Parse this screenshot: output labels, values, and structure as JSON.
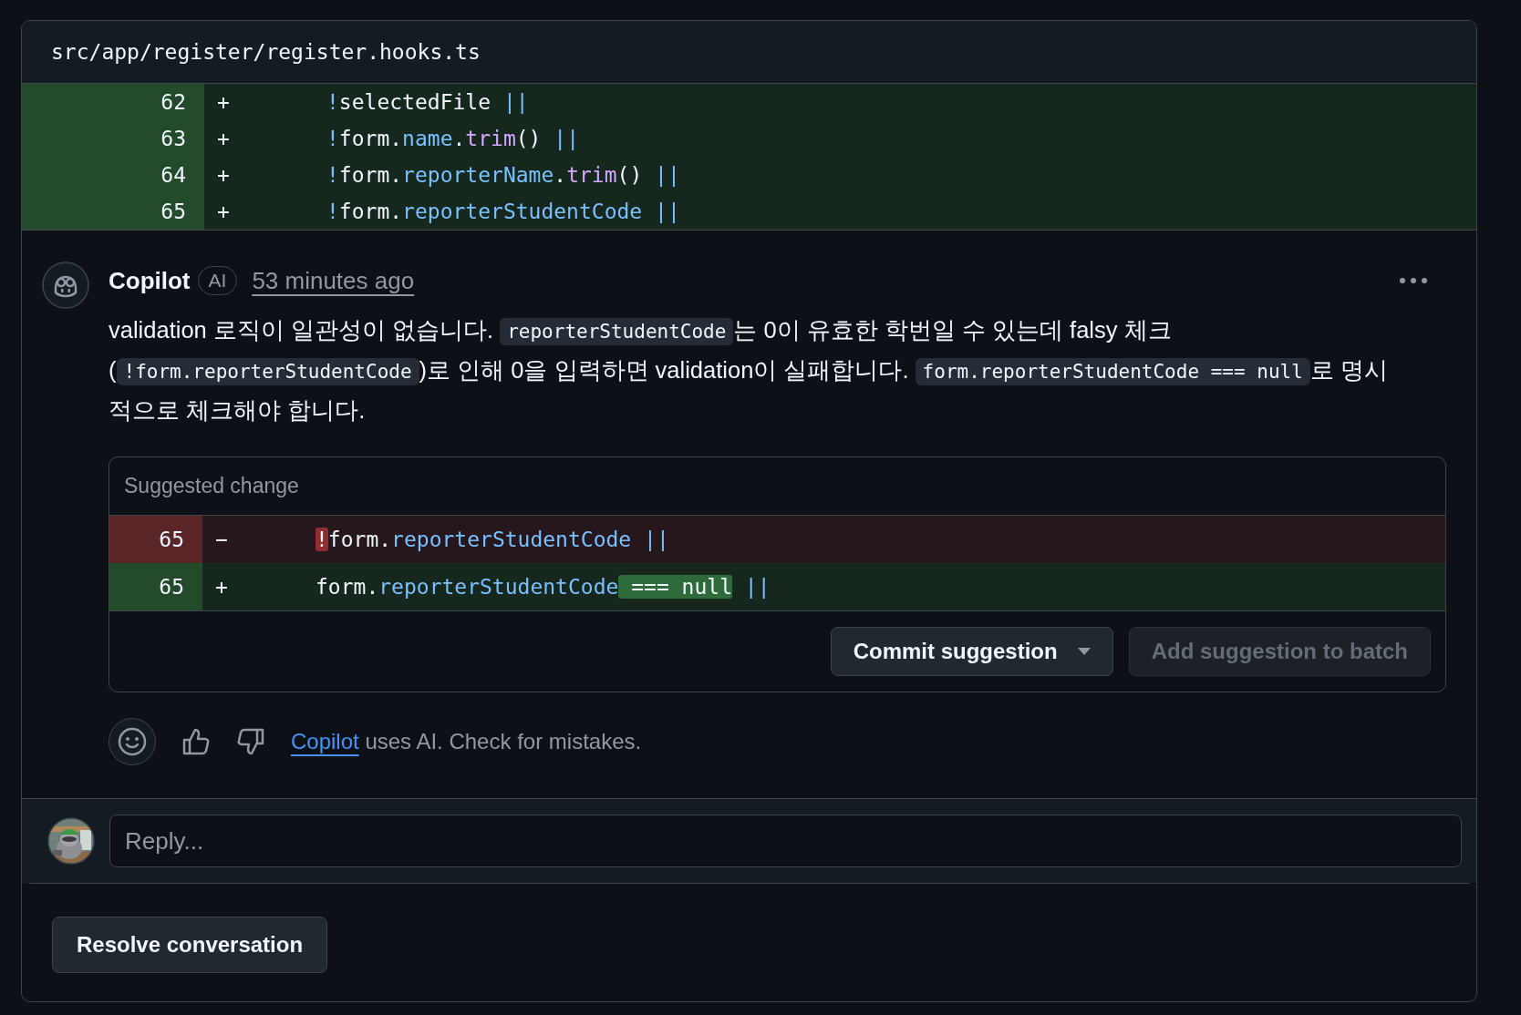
{
  "file_header": {
    "path": "src/app/register/register.hooks.ts"
  },
  "diff_lines": [
    {
      "line_number": "62",
      "sign": "+",
      "kind": "added",
      "tokens": [
        {
          "text": "!",
          "kind": "op"
        },
        {
          "text": "selectedFile",
          "kind": "plain"
        },
        {
          "text": " ||",
          "kind": "op"
        }
      ]
    },
    {
      "line_number": "63",
      "sign": "+",
      "kind": "added",
      "tokens": [
        {
          "text": "!",
          "kind": "op"
        },
        {
          "text": "form.",
          "kind": "plain"
        },
        {
          "text": "name",
          "kind": "prop"
        },
        {
          "text": ".",
          "kind": "plain"
        },
        {
          "text": "trim",
          "kind": "method"
        },
        {
          "text": "() ",
          "kind": "plain"
        },
        {
          "text": "||",
          "kind": "op"
        }
      ]
    },
    {
      "line_number": "64",
      "sign": "+",
      "kind": "added",
      "tokens": [
        {
          "text": "!",
          "kind": "op"
        },
        {
          "text": "form.",
          "kind": "plain"
        },
        {
          "text": "reporterName",
          "kind": "prop"
        },
        {
          "text": ".",
          "kind": "plain"
        },
        {
          "text": "trim",
          "kind": "method"
        },
        {
          "text": "() ",
          "kind": "plain"
        },
        {
          "text": "||",
          "kind": "op"
        }
      ]
    },
    {
      "line_number": "65",
      "sign": "+",
      "kind": "added",
      "tokens": [
        {
          "text": "!",
          "kind": "op"
        },
        {
          "text": "form.",
          "kind": "plain"
        },
        {
          "text": "reporterStudentCode",
          "kind": "prop"
        },
        {
          "text": " ||",
          "kind": "op"
        }
      ]
    }
  ],
  "comment": {
    "author": "Copilot",
    "badge": "AI",
    "time": "53 minutes ago",
    "body": [
      {
        "text": "validation 로직이 일관성이 없습니다. ",
        "kind": "text"
      },
      {
        "text": "reporterStudentCode",
        "kind": "code"
      },
      {
        "text": "는 0이 유효한 학번일 수 있는데 falsy 체크 (",
        "kind": "text"
      },
      {
        "text": "!form.reporterStudentCode",
        "kind": "code"
      },
      {
        "text": ")로 인해 0을 입력하면 validation이 실패합니다. ",
        "kind": "text"
      },
      {
        "text": "form.reporterStudentCode === null",
        "kind": "code"
      },
      {
        "text": "로 명시적으로 체크해야 합니다.",
        "kind": "text"
      }
    ],
    "suggestion": {
      "title": "Suggested change",
      "lines": [
        {
          "line_number": "65",
          "sign": "−",
          "kind": "deleted",
          "tokens": [
            {
              "text": "!",
              "kind": "deleted_highlight"
            },
            {
              "text": "form.",
              "kind": "plain"
            },
            {
              "text": "reporterStudentCode",
              "kind": "prop"
            },
            {
              "text": " ||",
              "kind": "op"
            }
          ]
        },
        {
          "line_number": "65",
          "sign": "+",
          "kind": "added",
          "tokens": [
            {
              "text": "form.",
              "kind": "plain"
            },
            {
              "text": "reporterStudentCode",
              "kind": "prop"
            },
            {
              "text": " === null",
              "kind": "added_highlight"
            },
            {
              "text": " ||",
              "kind": "op"
            }
          ]
        }
      ],
      "buttons": [
        {
          "label": "Commit suggestion",
          "disabled": false,
          "dropdown": true
        },
        {
          "label": "Add suggestion to batch",
          "disabled": true,
          "dropdown": false
        }
      ]
    },
    "footer": {
      "link": "Copilot",
      "text": " uses AI. Check for mistakes."
    }
  },
  "reply": {
    "placeholder": "Reply..."
  },
  "resolve_button": "Resolve conversation"
}
